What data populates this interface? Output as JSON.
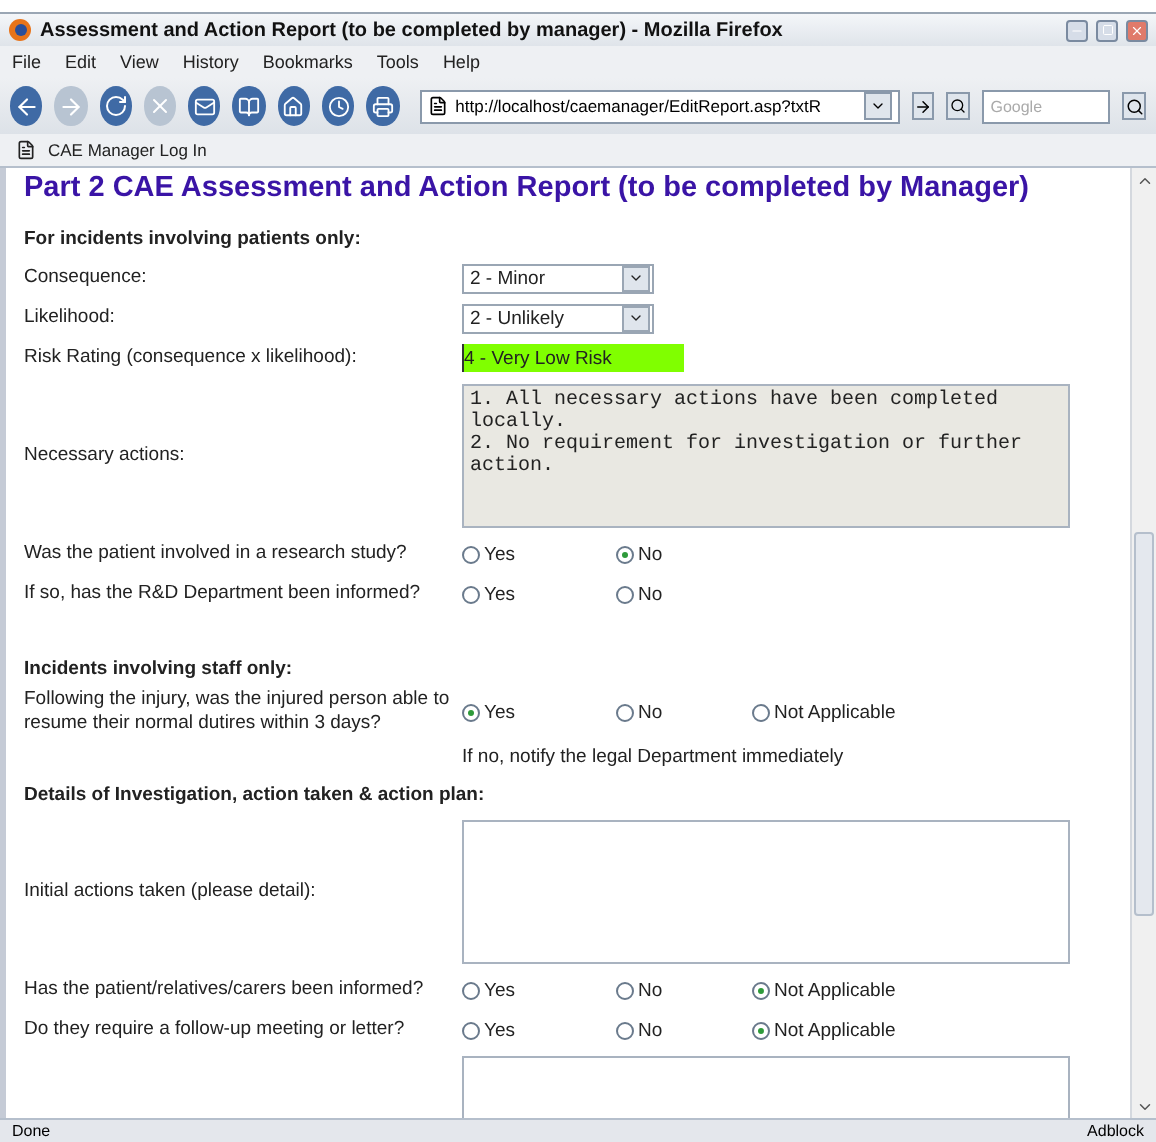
{
  "window": {
    "title": "Assessment and Action Report (to be completed by manager) - Mozilla Firefox"
  },
  "menu": [
    "File",
    "Edit",
    "View",
    "History",
    "Bookmarks",
    "Tools",
    "Help"
  ],
  "toolbar": {
    "url": "http://localhost/caemanager/EditReport.asp?txtR",
    "search_placeholder": "Google"
  },
  "bookmarks": [
    "CAE Manager Log In"
  ],
  "page": {
    "heading": "Part 2 CAE Assessment and Action Report (to be completed by Manager)",
    "rows": [
      {
        "kind": "heading",
        "text": "For incidents involving patients only:"
      },
      {
        "kind": "select",
        "label": "Consequence:",
        "value": "2 - Minor"
      },
      {
        "kind": "select",
        "label": "Likelihood:",
        "value": "2 - Unlikely"
      },
      {
        "kind": "rating",
        "label": "Risk Rating (consequence x likelihood):",
        "value": "4 - Very Low Risk",
        "color": "#80ff00"
      },
      {
        "kind": "textarea",
        "label": "Necessary actions:",
        "value": "1. All necessary actions have been completed locally.\n2. No requirement for investigation or further action.",
        "disabled": true
      },
      {
        "kind": "radio",
        "label": "Was the patient involved in a research study?",
        "options": [
          {
            "label": "Yes",
            "selected": false
          },
          {
            "label": "No",
            "selected": true
          }
        ]
      },
      {
        "kind": "radio",
        "label": "If so, has the R&D Department been informed?",
        "options": [
          {
            "label": "Yes",
            "selected": false
          },
          {
            "label": "No",
            "selected": false
          }
        ]
      },
      {
        "kind": "heading",
        "text": "Incidents involving staff only:"
      },
      {
        "kind": "radio",
        "label": "Following the injury, was the injured person able to resume their normal dutires within 3 days?",
        "options": [
          {
            "label": "Yes",
            "selected": true
          },
          {
            "label": "No",
            "selected": false
          },
          {
            "label": "Not Applicable",
            "selected": false
          }
        ]
      },
      {
        "kind": "note",
        "text": "If no, notify the legal Department immediately"
      },
      {
        "kind": "heading",
        "text": "Details of Investigation, action taken & action plan:"
      },
      {
        "kind": "textarea",
        "label": "Initial actions taken (please detail):",
        "disabled": false
      },
      {
        "kind": "radio",
        "label": "Has the patient/relatives/carers been informed?",
        "options": [
          {
            "label": "Yes",
            "selected": false
          },
          {
            "label": "No",
            "selected": false
          },
          {
            "label": "Not Applicable",
            "selected": true
          }
        ]
      },
      {
        "kind": "radio",
        "label": "Do they require a follow-up meeting or letter?",
        "options": [
          {
            "label": "Yes",
            "selected": false
          },
          {
            "label": "No",
            "selected": false
          },
          {
            "label": "Not Applicable",
            "selected": true
          }
        ]
      },
      {
        "kind": "textarea",
        "disabled": false
      }
    ]
  },
  "status_bar": {
    "text": "Done",
    "addon": "Adblock"
  }
}
